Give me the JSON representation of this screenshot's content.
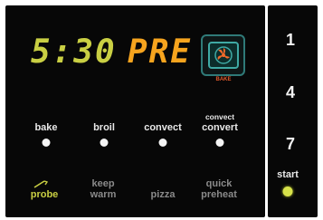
{
  "display": {
    "time": "5:30",
    "mode": "PRE",
    "bake_caption": "BAKE"
  },
  "buttons": {
    "bake": "bake",
    "broil": "broil",
    "convect": "convect",
    "convect_convert_line1": "convect",
    "convect_convert_line2": "convert",
    "probe": "probe",
    "keep_warm_line1": "keep",
    "keep_warm_line2": "warm",
    "pizza": "pizza",
    "quick_preheat_line1": "quick",
    "quick_preheat_line2": "preheat",
    "start": "start"
  },
  "keypad": {
    "key_1": "1",
    "key_4": "4",
    "key_7": "7"
  },
  "colors": {
    "time_digits": "#c9cf43",
    "mode_text": "#f6a41e",
    "bake_icon": "#3fa9a4",
    "bake_caption": "#e45a2c",
    "start_led": "#d7e24a"
  },
  "icons": {
    "bake_icon": "convection-fan-icon",
    "probe_icon": "probe-icon"
  }
}
